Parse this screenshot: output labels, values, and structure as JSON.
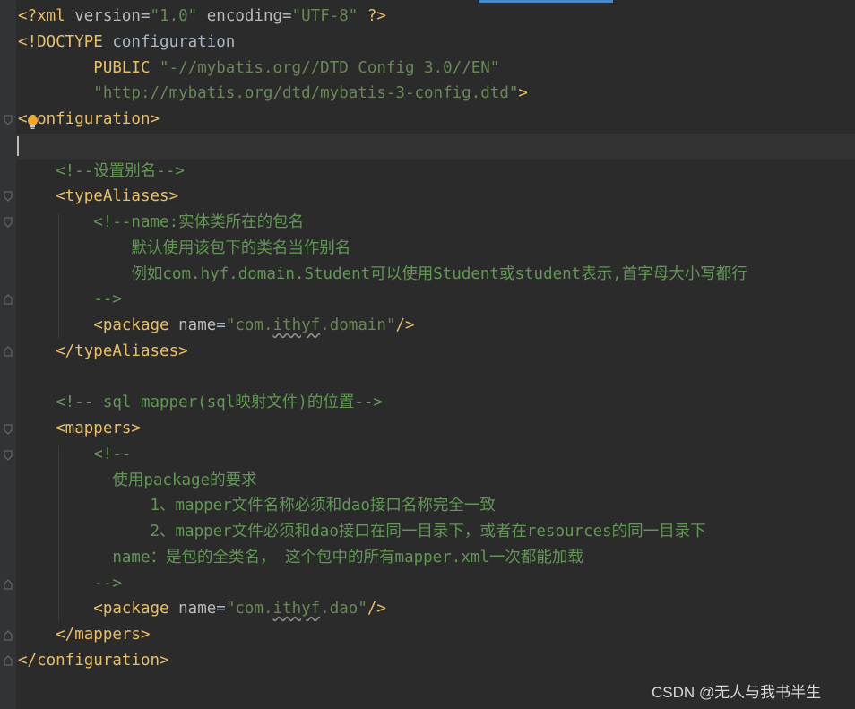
{
  "editor": {
    "lines": [
      {
        "parts": [
          {
            "c": "pi",
            "t": "<?xml "
          },
          {
            "c": "attr",
            "t": "version"
          },
          {
            "c": "txt",
            "t": "="
          },
          {
            "c": "str",
            "t": "\"1.0\""
          },
          {
            "c": "attr",
            "t": " encoding"
          },
          {
            "c": "txt",
            "t": "="
          },
          {
            "c": "str",
            "t": "\"UTF-8\""
          },
          {
            "c": "pi",
            "t": " ?>"
          }
        ]
      },
      {
        "parts": [
          {
            "c": "pi",
            "t": "<!DOCTYPE "
          },
          {
            "c": "txt",
            "t": "configuration"
          }
        ]
      },
      {
        "parts": [
          {
            "c": "pi",
            "t": "        PUBLIC "
          },
          {
            "c": "str",
            "t": "\"-//mybatis.org//DTD Config 3.0//EN\""
          }
        ]
      },
      {
        "parts": [
          {
            "c": "str",
            "t": "        \"http://mybatis.org/dtd/mybatis-3-config.dtd\""
          },
          {
            "c": "pi",
            "t": ">"
          }
        ]
      },
      {
        "parts": [
          {
            "c": "tag",
            "t": "<configuration>"
          }
        ]
      },
      {
        "parts": [
          {
            "c": "txt",
            "t": ""
          }
        ]
      },
      {
        "parts": [
          {
            "c": "cmt",
            "t": "    <!--设置别名-->"
          }
        ]
      },
      {
        "parts": [
          {
            "c": "tag",
            "t": "    <typeAliases>"
          }
        ]
      },
      {
        "parts": [
          {
            "c": "cmt",
            "t": "        <!--name:实体类所在的包名"
          }
        ]
      },
      {
        "parts": [
          {
            "c": "cmt",
            "t": "            默认使用该包下的类名当作别名"
          }
        ]
      },
      {
        "parts": [
          {
            "c": "cmt",
            "t": "            例如com.hyf.domain.Student可以使用Student或student表示,首字母大小写都行"
          }
        ]
      },
      {
        "parts": [
          {
            "c": "cmt",
            "t": "        -->"
          }
        ]
      },
      {
        "parts": [
          {
            "c": "tag",
            "t": "        <package "
          },
          {
            "c": "attr",
            "t": "name"
          },
          {
            "c": "txt",
            "t": "="
          },
          {
            "c": "str",
            "t": "\"com."
          },
          {
            "c": "str squig",
            "t": "ithyf"
          },
          {
            "c": "str",
            "t": ".domain\""
          },
          {
            "c": "tag",
            "t": "/>"
          }
        ]
      },
      {
        "parts": [
          {
            "c": "tag",
            "t": "    </typeAliases>"
          }
        ]
      },
      {
        "parts": [
          {
            "c": "txt",
            "t": ""
          }
        ]
      },
      {
        "parts": [
          {
            "c": "cmt",
            "t": "    <!-- sql mapper(sql映射文件)的位置-->"
          }
        ]
      },
      {
        "parts": [
          {
            "c": "tag",
            "t": "    <mappers>"
          }
        ]
      },
      {
        "parts": [
          {
            "c": "cmt",
            "t": "        <!--"
          }
        ]
      },
      {
        "parts": [
          {
            "c": "cmt",
            "t": "          使用package的要求"
          }
        ]
      },
      {
        "parts": [
          {
            "c": "cmt",
            "t": "              1、mapper文件名称必须和dao接口名称完全一致"
          }
        ]
      },
      {
        "parts": [
          {
            "c": "cmt",
            "t": "              2、mapper文件必须和dao接口在同一目录下，或者在resources的同一目录下"
          }
        ]
      },
      {
        "parts": [
          {
            "c": "cmt",
            "t": "          name：是包的全类名， 这个包中的所有mapper.xml一次都能加载"
          }
        ]
      },
      {
        "parts": [
          {
            "c": "cmt",
            "t": "        -->"
          }
        ]
      },
      {
        "parts": [
          {
            "c": "tag",
            "t": "        <package "
          },
          {
            "c": "attr",
            "t": "name"
          },
          {
            "c": "txt",
            "t": "="
          },
          {
            "c": "str",
            "t": "\"com."
          },
          {
            "c": "str squig",
            "t": "ithyf"
          },
          {
            "c": "str",
            "t": ".dao\""
          },
          {
            "c": "tag",
            "t": "/>"
          }
        ]
      },
      {
        "parts": [
          {
            "c": "tag",
            "t": "    </mappers>"
          }
        ]
      },
      {
        "parts": [
          {
            "c": "tag",
            "t": "</configuration>"
          }
        ]
      }
    ]
  },
  "watermark": "CSDN @无人与我书半生",
  "icons": {
    "bulb": "lightbulb-icon",
    "fold": "fold-marker-icon"
  }
}
